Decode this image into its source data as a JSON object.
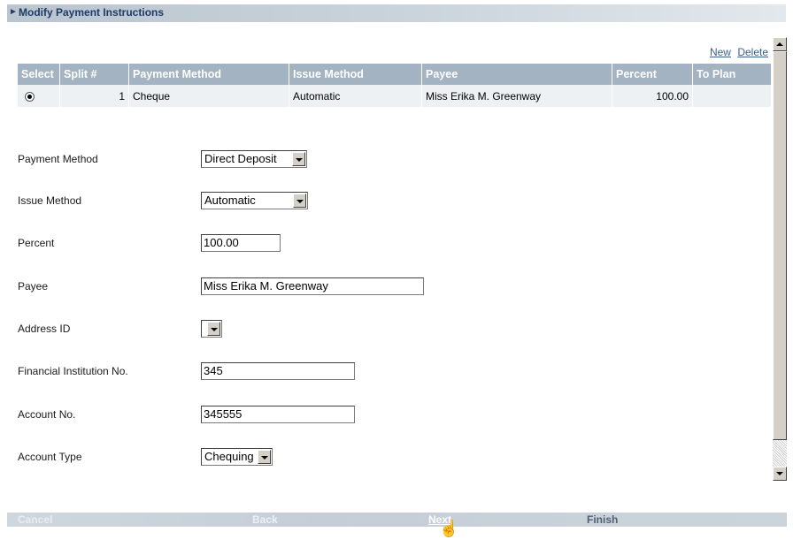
{
  "header": {
    "title": "Modify Payment Instructions",
    "arrow": "►"
  },
  "links": {
    "new": "New",
    "delete": "Delete"
  },
  "table": {
    "columns": [
      "Select",
      "Split #",
      "Payment Method",
      "Issue Method",
      "Payee",
      "Percent",
      "To Plan"
    ],
    "rows": [
      {
        "split": "1",
        "payment_method": "Cheque",
        "issue_method": "Automatic",
        "payee": "Miss Erika M. Greenway",
        "percent": "100.00",
        "to_plan": ""
      }
    ]
  },
  "form": {
    "payment_method": {
      "label": "Payment Method",
      "value": "Direct Deposit"
    },
    "issue_method": {
      "label": "Issue Method",
      "value": "Automatic"
    },
    "percent": {
      "label": "Percent",
      "value": "100.00"
    },
    "payee": {
      "label": "Payee",
      "value": "Miss Erika M. Greenway"
    },
    "address_id": {
      "label": "Address ID",
      "value": ""
    },
    "financial_institution_no": {
      "label": "Financial Institution No.",
      "value": "345"
    },
    "account_no": {
      "label": "Account No.",
      "value": "345555"
    },
    "account_type": {
      "label": "Account Type",
      "value": "Chequing"
    }
  },
  "footer": {
    "cancel": "Cancel",
    "back": "Back",
    "next": "Next",
    "finish": "Finish"
  }
}
